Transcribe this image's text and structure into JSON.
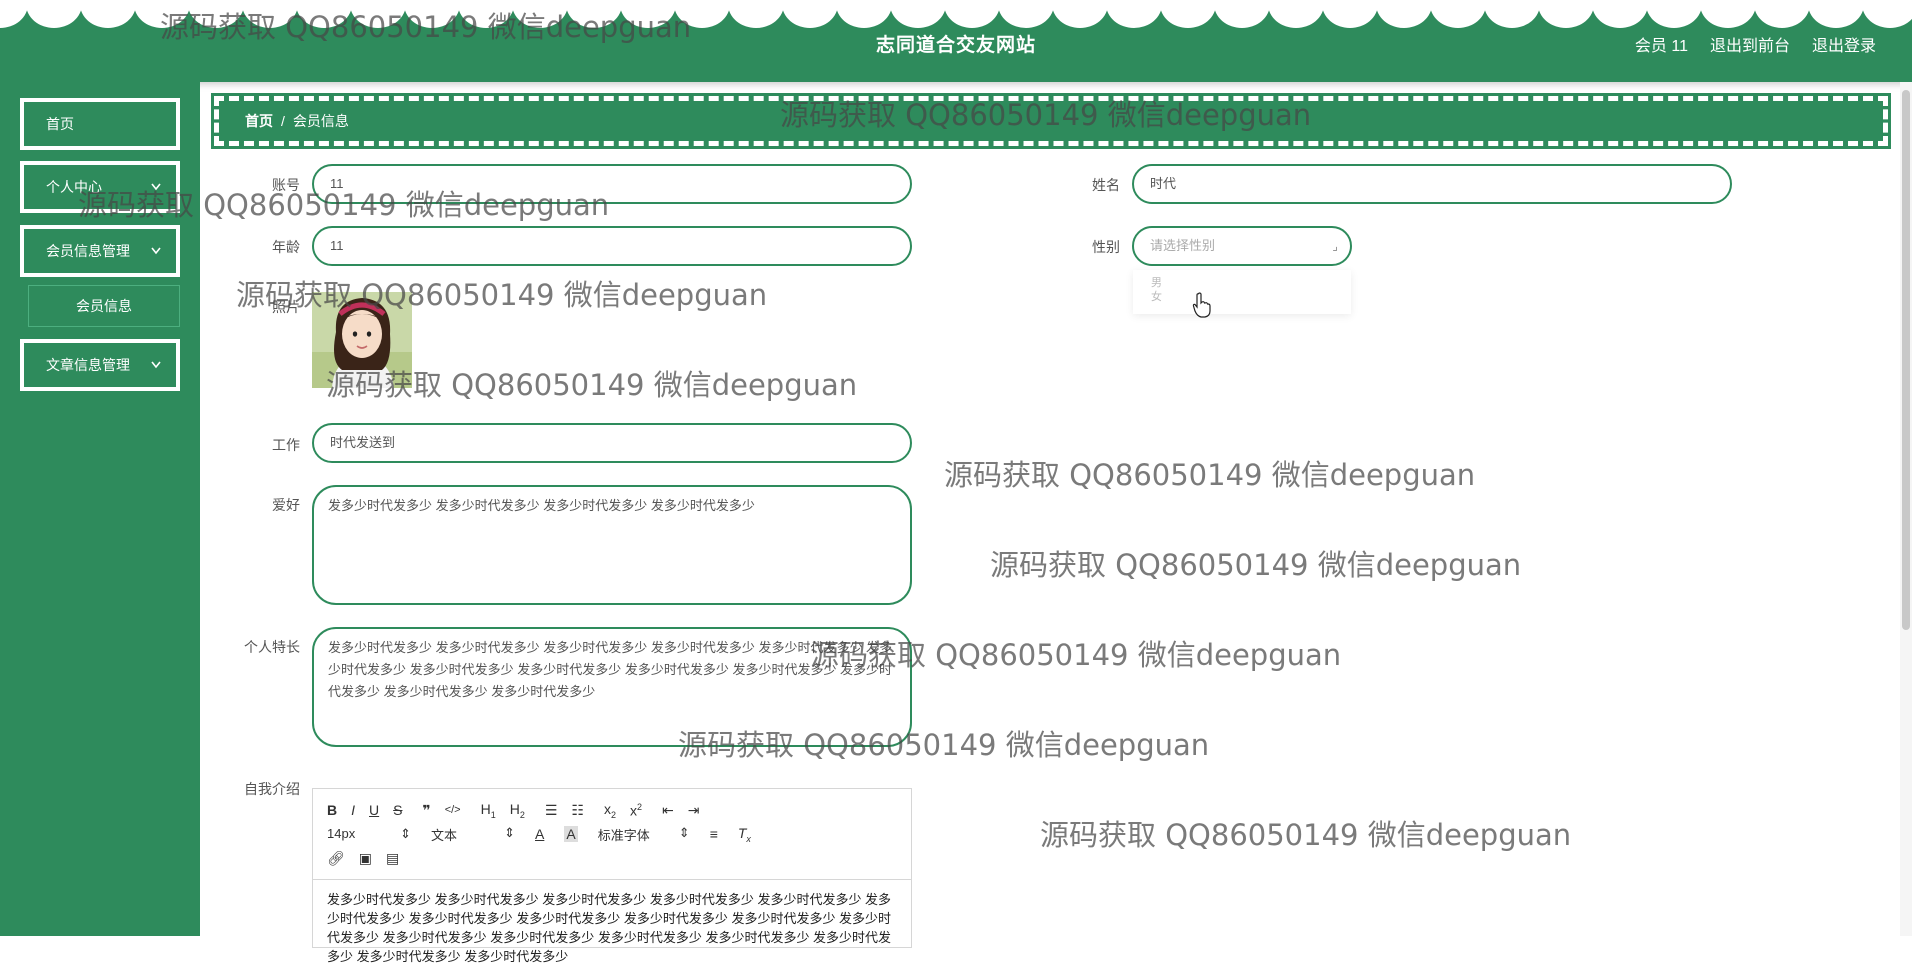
{
  "header": {
    "title": "志同道合交友网站",
    "links": [
      "会员 11",
      "退出到前台",
      "退出登录"
    ]
  },
  "sidebar": {
    "items": [
      {
        "label": "首页",
        "has_chevron": false
      },
      {
        "label": "个人中心",
        "has_chevron": true
      },
      {
        "label": "会员信息管理",
        "has_chevron": true
      },
      {
        "label": "会员信息",
        "submenu": true
      },
      {
        "label": "文章信息管理",
        "has_chevron": true
      }
    ],
    "chevron_icon": "chevron-down-icon"
  },
  "breadcrumb": {
    "home": "首页",
    "separator": "/",
    "current": "会员信息"
  },
  "form": {
    "account": {
      "label": "账号",
      "value": "11"
    },
    "name": {
      "label": "姓名",
      "value": "时代"
    },
    "age": {
      "label": "年龄",
      "value": "11"
    },
    "gender": {
      "label": "性别",
      "placeholder": "请选择性别",
      "options": [
        "男",
        "女"
      ]
    },
    "photo": {
      "label": "照片"
    },
    "job": {
      "label": "工作",
      "value": "时代发送到"
    },
    "hobby": {
      "label": "爱好",
      "value": "发多少时代发多少 发多少时代发多少 发多少时代发多少 发多少时代发多少"
    },
    "specialty": {
      "label": "个人特长",
      "value": "发多少时代发多少 发多少时代发多少 发多少时代发多少 发多少时代发多少 发多少时代发多少 发多少时代发多少 发多少时代发多少 发多少时代发多少 发多少时代发多少 发多少时代发多少 发多少时代发多少 发多少时代发多少 发多少时代发多少"
    },
    "intro": {
      "label": "自我介绍"
    }
  },
  "editor": {
    "font_size": "14px",
    "paragraph": "文本",
    "font_family": "标准字体",
    "content": "发多少时代发多少 发多少时代发多少 发多少时代发多少 发多少时代发多少 发多少时代发多少 发多少时代发多少 发多少时代发多少 发多少时代发多少 发多少时代发多少 发多少时代发多少 发多少时代发多少 发多少时代发多少 发多少时代发多少 发多少时代发多少 发多少时代发多少 发多少时代发多少 发多少时代发多少 发多少时代发多少",
    "toolbar_icons": [
      "bold-icon",
      "italic-icon",
      "underline-icon",
      "strike-icon",
      "quote-icon",
      "code-icon",
      "h1-icon",
      "h2-icon",
      "ordered-list-icon",
      "bullet-list-icon",
      "subscript-icon",
      "superscript-icon",
      "outdent-icon",
      "indent-icon",
      "font-color-icon",
      "background-color-icon",
      "align-icon",
      "clear-format-icon",
      "link-icon",
      "image-icon",
      "video-icon"
    ]
  },
  "watermark": {
    "text": "源码获取 QQ86050149 微信deepguan"
  },
  "colors": {
    "primary": "#2e8b5c",
    "white": "#ffffff"
  }
}
